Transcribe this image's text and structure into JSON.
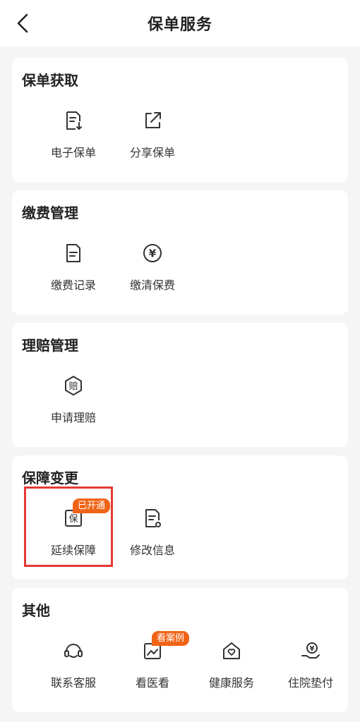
{
  "header": {
    "title": "保单服务",
    "back_icon": "chevron-left-icon"
  },
  "sections": [
    {
      "title": "保单获取",
      "items": [
        {
          "label": "电子保单",
          "icon": "document-download-icon"
        },
        {
          "label": "分享保单",
          "icon": "share-icon"
        }
      ]
    },
    {
      "title": "缴费管理",
      "items": [
        {
          "label": "缴费记录",
          "icon": "document-list-icon"
        },
        {
          "label": "缴清保费",
          "icon": "yuan-circle-icon"
        }
      ]
    },
    {
      "title": "理赔管理",
      "items": [
        {
          "label": "申请理赔",
          "icon": "claim-hexagon-icon",
          "glyph": "赔"
        }
      ]
    },
    {
      "title": "保障变更",
      "items": [
        {
          "label": "延续保障",
          "icon": "renew-coverage-icon",
          "glyph": "保",
          "badge": "已开通"
        },
        {
          "label": "修改信息",
          "icon": "edit-document-icon"
        }
      ]
    },
    {
      "title": "其他",
      "items": [
        {
          "label": "联系客服",
          "icon": "headset-icon"
        },
        {
          "label": "看医看",
          "icon": "photo-frame-icon",
          "badge": "看案例"
        },
        {
          "label": "健康服务",
          "icon": "house-heart-icon"
        },
        {
          "label": "住院垫付",
          "icon": "hand-yuan-icon",
          "glyph": "¥"
        }
      ]
    }
  ],
  "colors": {
    "accent": "#f06418",
    "highlight": "#e53935",
    "icon": "#333333"
  }
}
